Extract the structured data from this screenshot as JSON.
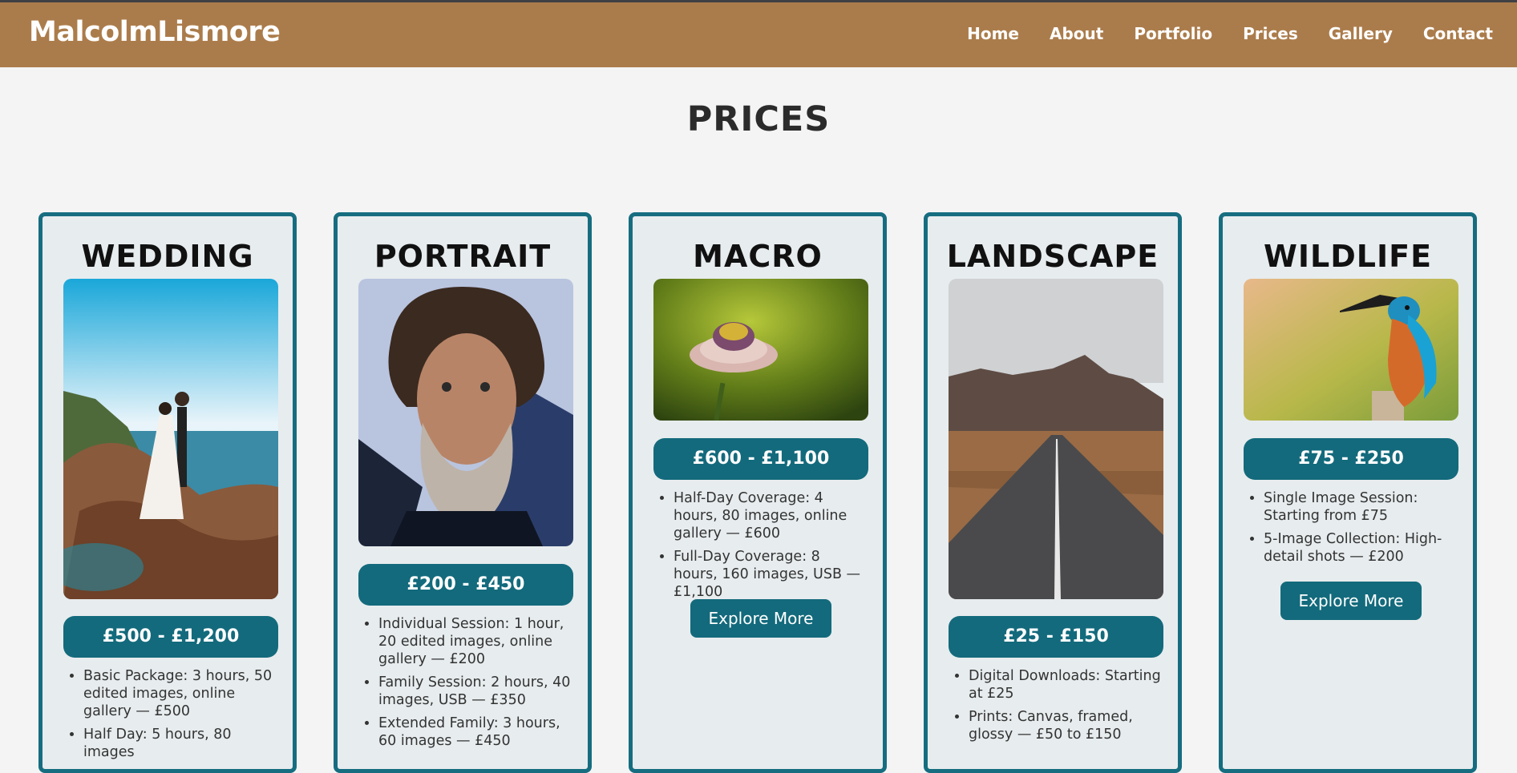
{
  "brand": "MalcolmLismore",
  "nav": [
    "Home",
    "About",
    "Portfolio",
    "Prices",
    "Gallery",
    "Contact"
  ],
  "page_title": "PRICES",
  "colors": {
    "header": "#ab7c4b",
    "accent": "#136a7c",
    "card_bg": "#e7ecee"
  },
  "cards": [
    {
      "title": "WEDDING",
      "price": "£500 - £1,200",
      "features": [
        "Basic Package: 3 hours, 50 edited images, online gallery — £500",
        "Half Day: 5 hours, 80 images"
      ],
      "button": ""
    },
    {
      "title": "PORTRAIT",
      "price": "£200 - £450",
      "features": [
        "Individual Session: 1 hour, 20 edited images, online gallery — £200",
        "Family Session: 2 hours, 40 images, USB — £350",
        "Extended Family: 3 hours, 60 images — £450"
      ],
      "button": ""
    },
    {
      "title": "MACRO",
      "price": "£600 - £1,100",
      "features": [
        "Half-Day Coverage: 4 hours, 80 images, online gallery — £600",
        "Full-Day Coverage: 8 hours, 160 images, USB — £1,100"
      ],
      "button": "Explore More"
    },
    {
      "title": "LANDSCAPE",
      "price": "£25 - £150",
      "features": [
        "Digital Downloads: Starting at £25",
        "Prints: Canvas, framed, glossy — £50 to £150"
      ],
      "button": ""
    },
    {
      "title": "WILDLIFE",
      "price": "£75 - £250",
      "features": [
        "Single Image Session: Starting from £75",
        "5-Image Collection: High-detail shots — £200"
      ],
      "button": "Explore More"
    }
  ]
}
